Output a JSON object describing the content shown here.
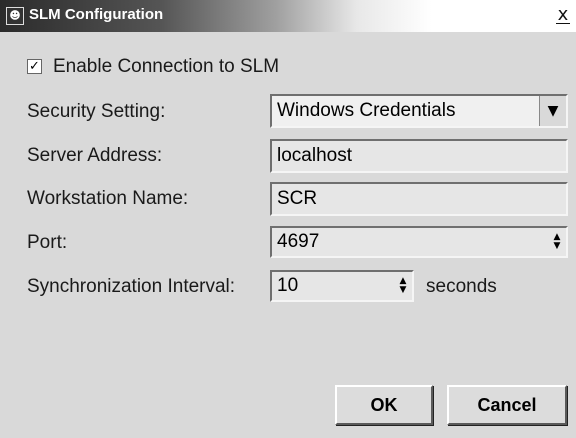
{
  "window": {
    "title": "SLM Configuration",
    "close_glyph": "x",
    "icon": "app-icon"
  },
  "enable": {
    "checked": true,
    "check_glyph": "✓",
    "label": "Enable Connection to SLM"
  },
  "security": {
    "label": "Security Setting:",
    "value": "Windows Credentials",
    "arrow_glyph": "▼"
  },
  "server": {
    "label": "Server Address:",
    "value": "localhost"
  },
  "workstation": {
    "label": "Workstation Name:",
    "value": "SCR"
  },
  "port": {
    "label": "Port:",
    "value": "4697"
  },
  "sync": {
    "label": "Synchronization Interval:",
    "value": "10",
    "unit": "seconds"
  },
  "spinner": {
    "up_glyph": "▲",
    "down_glyph": "▼"
  },
  "buttons": {
    "ok": "OK",
    "cancel": "Cancel"
  }
}
